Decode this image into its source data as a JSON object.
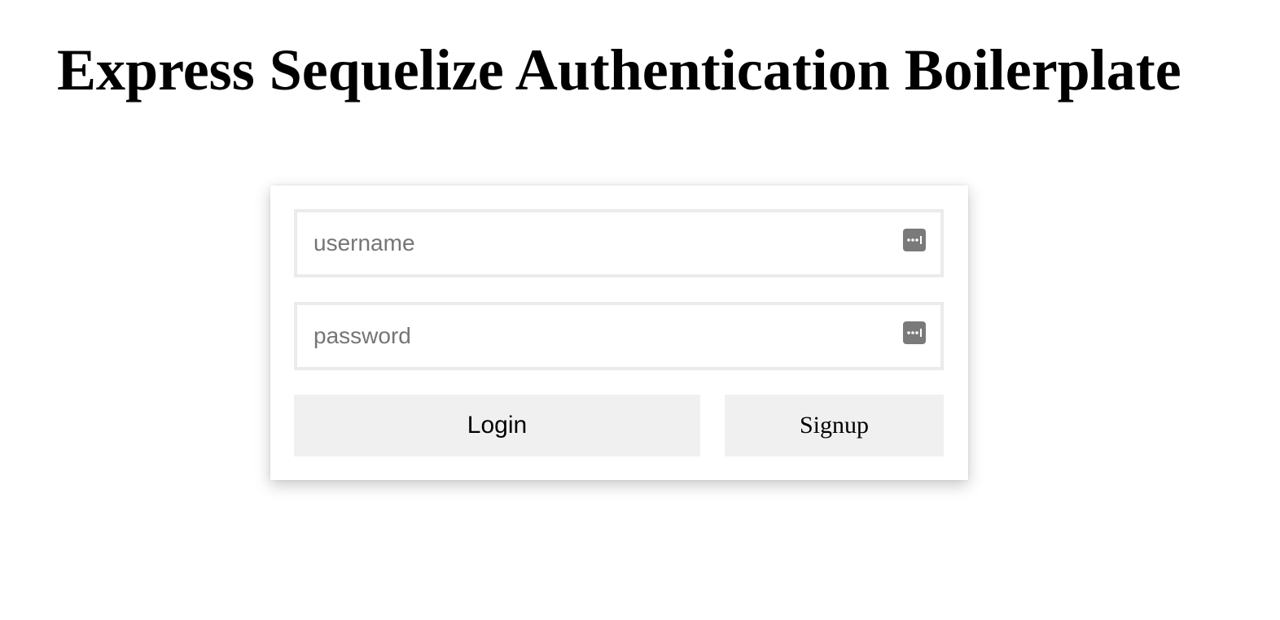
{
  "header": {
    "title": "Express Sequelize Authentication Boilerplate"
  },
  "login_form": {
    "username": {
      "placeholder": "username",
      "value": "",
      "icon": "password-manager-key-icon"
    },
    "password": {
      "placeholder": "password",
      "value": "",
      "icon": "password-manager-key-icon"
    },
    "login_label": "Login",
    "signup_label": "Signup"
  },
  "colors": {
    "background": "#ffffff",
    "button_background": "#f0f0f0",
    "input_border": "#ebebeb",
    "icon": "#7a7a7a"
  }
}
